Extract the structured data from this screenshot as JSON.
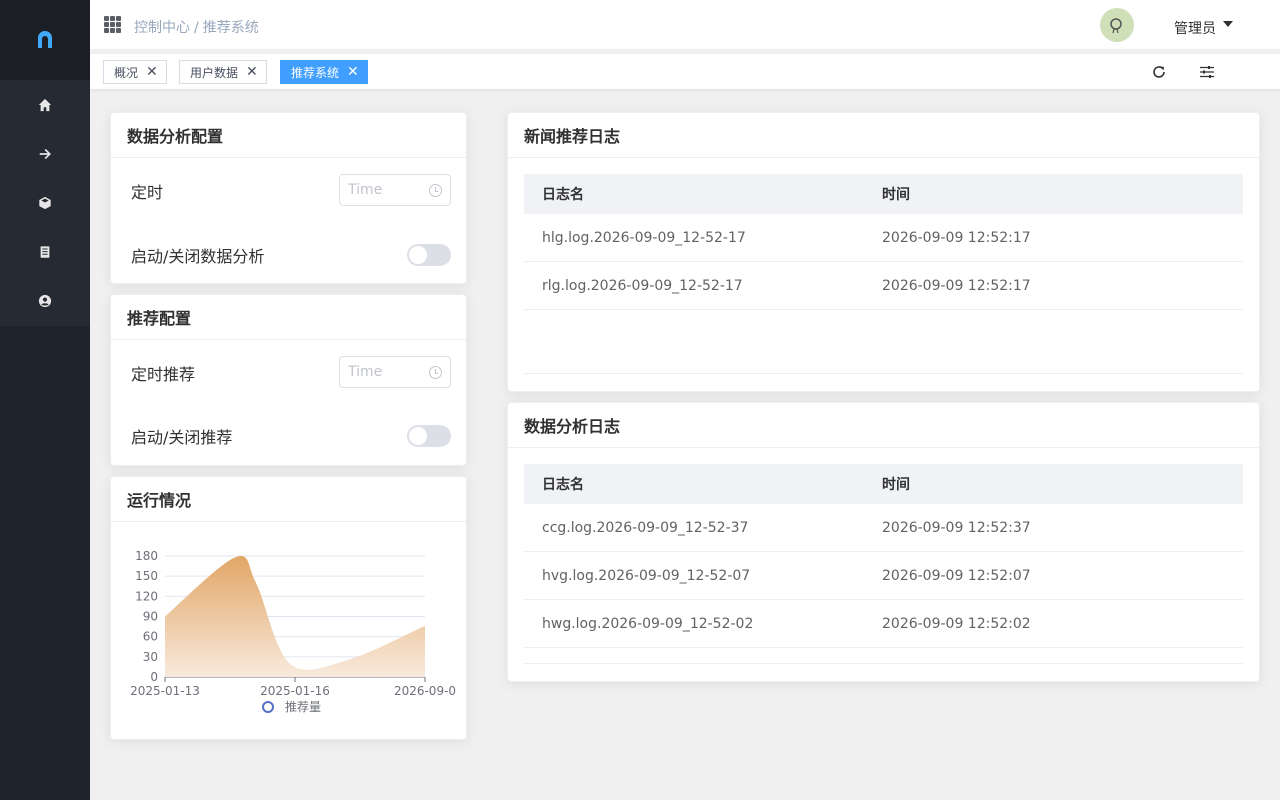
{
  "header": {
    "breadcrumb": [
      "控制中心",
      "推荐系统"
    ],
    "breadcrumb_sep": "/",
    "user_name": "管理员"
  },
  "sidebar": {
    "items": [
      {
        "icon": "home-icon"
      },
      {
        "icon": "arrow-right-icon"
      },
      {
        "icon": "cube-icon"
      },
      {
        "icon": "document-icon"
      },
      {
        "icon": "user-circle-icon"
      }
    ]
  },
  "tags": [
    {
      "label": "概况",
      "active": false
    },
    {
      "label": "用户数据",
      "active": false
    },
    {
      "label": "推荐系统",
      "active": true
    }
  ],
  "analysis_config": {
    "title": "数据分析配置",
    "schedule_label": "定时",
    "schedule_placeholder": "Time",
    "toggle_label": "启动/关闭数据分析",
    "toggle_on": false
  },
  "recommend_config": {
    "title": "推荐配置",
    "schedule_label": "定时推荐",
    "schedule_placeholder": "Time",
    "toggle_label": "启动/关闭推荐",
    "toggle_on": false
  },
  "status": {
    "title": "运行情况"
  },
  "news_log": {
    "title": "新闻推荐日志",
    "columns": [
      "日志名",
      "时间"
    ],
    "rows": [
      [
        "hlg.log.2026-09-09_12-52-17",
        "2026-09-09 12:52:17"
      ],
      [
        "rlg.log.2026-09-09_12-52-17",
        "2026-09-09 12:52:17"
      ]
    ]
  },
  "analysis_log": {
    "title": "数据分析日志",
    "columns": [
      "日志名",
      "时间"
    ],
    "rows": [
      [
        "ccg.log.2026-09-09_12-52-37",
        "2026-09-09 12:52:37"
      ],
      [
        "hvg.log.2026-09-09_12-52-07",
        "2026-09-09 12:52:07"
      ],
      [
        "hwg.log.2026-09-09_12-52-02",
        "2026-09-09 12:52:02"
      ]
    ]
  },
  "colors": {
    "accent": "#409eff",
    "sidebar": "#1f232b",
    "area_top": "#e0a25e",
    "area_bottom": "#f8e9db"
  },
  "chart_data": {
    "type": "area",
    "x": [
      "2025-01-13",
      "2025-01-16",
      "2026-09-0"
    ],
    "ticks_y": [
      0,
      30,
      60,
      90,
      120,
      150,
      180
    ],
    "ylim": [
      0,
      180
    ],
    "series": [
      {
        "name": "推荐量",
        "values": [
          [
            0,
            90
          ],
          [
            0.27,
            178
          ],
          [
            0.35,
            140
          ],
          [
            0.48,
            20
          ],
          [
            0.7,
            25
          ],
          [
            1.0,
            76
          ]
        ]
      }
    ],
    "legend_position": "bottom",
    "grid": true
  }
}
